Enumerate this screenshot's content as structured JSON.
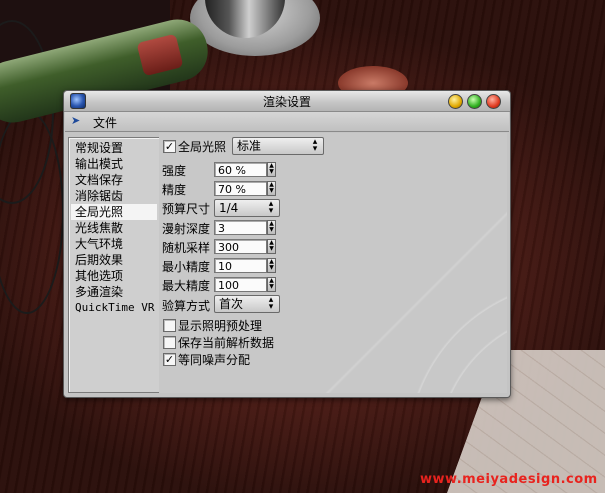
{
  "window": {
    "title": "渲染设置"
  },
  "menu": {
    "file_label": "文件"
  },
  "nav": {
    "items": [
      {
        "label": "常规设置"
      },
      {
        "label": "输出模式"
      },
      {
        "label": "文档保存"
      },
      {
        "label": "消除锯齿"
      },
      {
        "label": "全局光照"
      },
      {
        "label": "光线焦散"
      },
      {
        "label": "大气环境"
      },
      {
        "label": "后期效果"
      },
      {
        "label": "其他选项"
      },
      {
        "label": "多通渲染"
      },
      {
        "label": "QuickTime VR"
      }
    ],
    "selected_index": 4
  },
  "gi": {
    "checkbox_label": "全局光照",
    "checked": true,
    "mode_value": "标准",
    "intensity_label": "强度",
    "intensity_value": "60 %",
    "accuracy_label": "精度",
    "accuracy_value": "70 %",
    "prepass_label": "预算尺寸",
    "prepass_value": "1/4",
    "diffuse_label": "漫射深度",
    "diffuse_value": "3",
    "samples_label": "随机采样",
    "samples_value": "300",
    "min_label": "最小精度",
    "min_value": "10",
    "max_label": "最大精度",
    "max_value": "100",
    "check_label": "验算方式",
    "check_value": "首次",
    "show_prepass_label": "显示照明预处理",
    "show_prepass_checked": false,
    "save_solution_label": "保存当前解析数据",
    "save_solution_checked": false,
    "noise_label": "等同噪声分配",
    "noise_checked": true
  },
  "watermark": "www.meiyadesign.com",
  "check_mark": "✓"
}
